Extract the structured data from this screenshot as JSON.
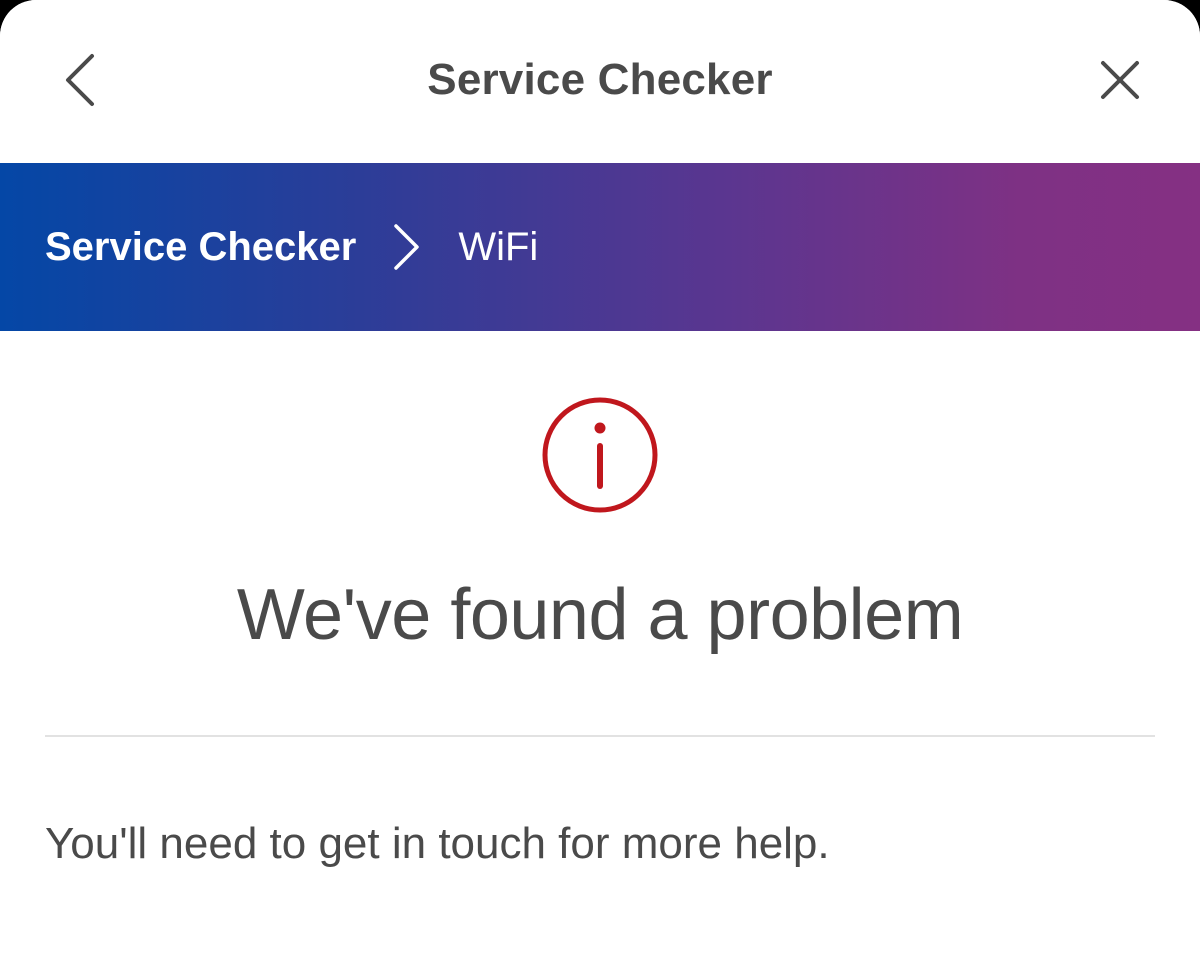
{
  "app_bar": {
    "title": "Service Checker",
    "back_icon": "chevron-left-icon",
    "close_icon": "close-icon"
  },
  "breadcrumb": {
    "root": "Service Checker",
    "separator_icon": "chevron-right-icon",
    "current": "WiFi",
    "gradient_start": "#0447a6",
    "gradient_end": "#853083"
  },
  "alert": {
    "icon": "info-icon",
    "color": "#c0171d",
    "headline": "We've found a problem",
    "message": "You'll need to get in touch for more help."
  }
}
